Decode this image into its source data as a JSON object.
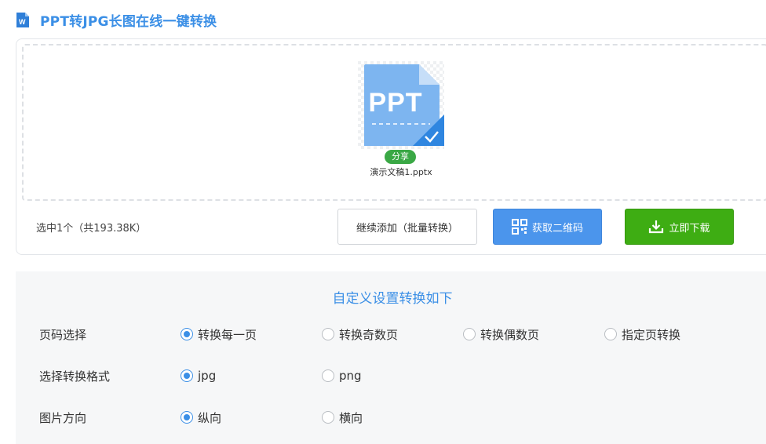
{
  "header": {
    "title": "PPT转JPG长图在线一键转换",
    "logo_icon": "word-doc-icon",
    "title_color": "#3b8fe6"
  },
  "upload": {
    "file": {
      "type_label": "PPT",
      "badge": "分享",
      "name": "演示文稿1.pptx",
      "selected": true
    },
    "selection_info": "选中1个（共193.38K）",
    "buttons": {
      "add_label": "继续添加（批量转换）",
      "qr_label": "获取二维码",
      "qr_icon": "qr-code-icon",
      "download_label": "立即下载",
      "download_icon": "download-icon"
    }
  },
  "settings": {
    "title": "自定义设置转换如下",
    "rows": [
      {
        "label": "页码选择",
        "options": [
          "转换每一页",
          "转换奇数页",
          "转换偶数页",
          "指定页转换"
        ],
        "selected": 0
      },
      {
        "label": "选择转换格式",
        "options": [
          "jpg",
          "png"
        ],
        "selected": 0
      },
      {
        "label": "图片方向",
        "options": [
          "纵向",
          "横向"
        ],
        "selected": 0
      }
    ]
  },
  "colors": {
    "accent": "#3b8fe6",
    "qr_button": "#4b95ec",
    "download_button": "#3ead13",
    "share_badge": "#3aa845"
  }
}
